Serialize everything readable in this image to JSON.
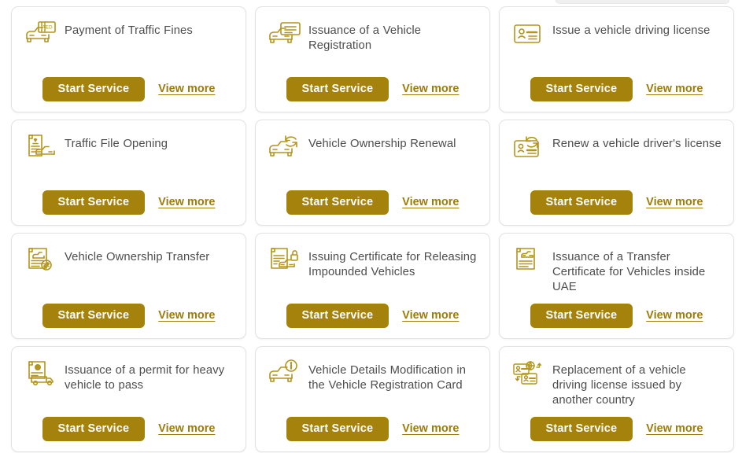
{
  "page": {
    "background": "#ffffff",
    "accent_color": "#a5820c",
    "link_color": "#9c7c0d",
    "title_color": "#4d4d4d",
    "card_border_color": "#e2e2e2"
  },
  "actions": {
    "start_label": "Start Service",
    "view_more_label": "View more"
  },
  "cards": [
    {
      "title": "Payment of Traffic Fines",
      "icon": "car-fine-ticket-icon",
      "start_label": "Start Service",
      "view_more_label": "View more"
    },
    {
      "title": "Issuance of a Vehicle Registration",
      "icon": "car-registration-card-icon",
      "start_label": "Start Service",
      "view_more_label": "View more"
    },
    {
      "title": "Issue a vehicle driving license",
      "icon": "id-license-card-icon",
      "start_label": "Start Service",
      "view_more_label": "View more"
    },
    {
      "title": "Traffic File Opening",
      "icon": "document-car-file-icon",
      "start_label": "Start Service",
      "view_more_label": "View more"
    },
    {
      "title": "Vehicle Ownership Renewal",
      "icon": "car-renew-arrows-icon",
      "start_label": "Start Service",
      "view_more_label": "View more"
    },
    {
      "title": "Renew a vehicle driver's license",
      "icon": "license-renew-arrows-icon",
      "start_label": "Start Service",
      "view_more_label": "View more"
    },
    {
      "title": "Vehicle Ownership Transfer",
      "icon": "document-car-transfer-icon",
      "start_label": "Start Service",
      "view_more_label": "View more"
    },
    {
      "title": "Issuing Certificate for Releasing Impounded Vehicles",
      "icon": "document-car-unlock-icon",
      "start_label": "Start Service",
      "view_more_label": "View more"
    },
    {
      "title": "Issuance of a Transfer Certificate for Vehicles inside UAE",
      "icon": "document-car-certificate-icon",
      "start_label": "Start Service",
      "view_more_label": "View more"
    },
    {
      "title": "Issuance of a permit for heavy vehicle to pass",
      "icon": "document-truck-permit-icon",
      "start_label": "Start Service",
      "view_more_label": "View more"
    },
    {
      "title": "Vehicle Details Modification in the Vehicle Registration Card",
      "icon": "car-info-icon",
      "start_label": "Start Service",
      "view_more_label": "View more"
    },
    {
      "title": "Replacement of a vehicle driving license issued by another country",
      "icon": "license-globe-exchange-icon",
      "start_label": "Start Service",
      "view_more_label": "View more"
    }
  ]
}
